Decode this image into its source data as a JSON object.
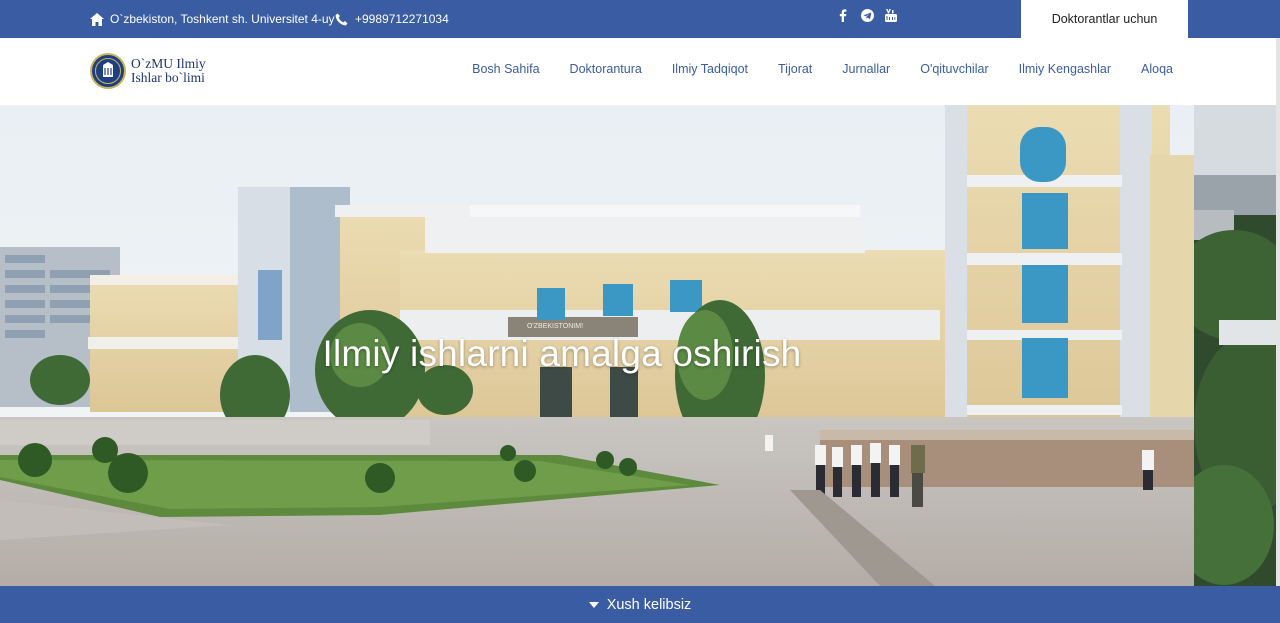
{
  "topbar": {
    "address": "O`zbekiston, Toshkent sh. Universitet 4-uy",
    "phone": "+9989712271034",
    "socials": [
      "facebook-icon",
      "telegram-icon",
      "youtube-icon"
    ],
    "doctoral_button": "Doktorantlar uchun",
    "color": "#3a5ca3"
  },
  "brand": {
    "line1": "O`zMU Ilmiy",
    "line2": "Ishlar bo`limi"
  },
  "nav": {
    "items": [
      "Bosh Sahifa",
      "Doktorantura",
      "Ilmiy Tadqiqot",
      "Tijorat",
      "Jurnallar",
      "O'qituvchilar",
      "Ilmiy Kengashlar",
      "Aloqa"
    ]
  },
  "hero": {
    "title": "Ilmiy ishlarni amalga oshirish",
    "sign_text": "O'ZBEKISTONIM!"
  },
  "bottom": {
    "label": "Xush kelibsiz"
  }
}
